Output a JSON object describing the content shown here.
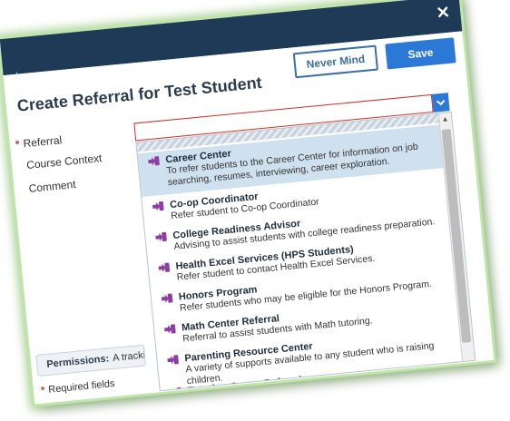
{
  "modal": {
    "title": "Create Referral for Test Student",
    "never_mind_label": "Never Mind",
    "save_label": "Save"
  },
  "form": {
    "referral_label": "Referral",
    "course_context_label": "Course Context",
    "comment_label": "Comment",
    "permissions_label": "Permissions:",
    "permissions_text": "A trackin",
    "required_label": "Required fields"
  },
  "dropdown": {
    "items": [
      {
        "name": "Career Center",
        "desc": "To refer students to the Career Center for information on job searching, resumes, interviewing, career exploration.",
        "selected": true
      },
      {
        "name": "Co-op Coordinator",
        "desc": "Refer student to Co-op Coordinator"
      },
      {
        "name": "College Readiness Advisor",
        "desc": "Advising to assist students with college readiness preparation."
      },
      {
        "name": "Health Excel Services (HPS Students)",
        "desc": "Refer student to contact Health Excel Services."
      },
      {
        "name": "Honors Program",
        "desc": "Refer students who may be eligible for the Honors Program."
      },
      {
        "name": "Math Center Referral",
        "desc": "Referral to assist students with Math tutoring."
      },
      {
        "name": "Parenting Resource Center",
        "desc": "A variety of supports available to any student who is raising children."
      },
      {
        "name": "Tutoring Center Referral",
        "desc": ""
      }
    ]
  },
  "colors": {
    "topbar": "#1f3a57",
    "accent": "#2c78d7",
    "required": "#c0392b",
    "item_icon": "#8e3ea3",
    "selected_bg": "#cfe0ee"
  }
}
